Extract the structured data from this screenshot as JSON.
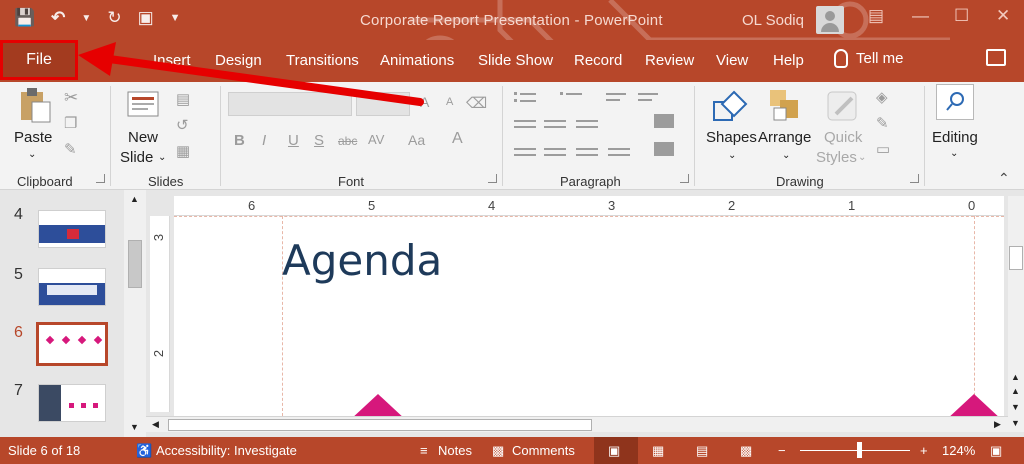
{
  "window": {
    "doc_title": "Corporate Report Presentation  -  PowerPoint",
    "user_name": "OL Sodiq"
  },
  "tabs": {
    "file": "File",
    "items": [
      "Insert",
      "Design",
      "Transitions",
      "Animations",
      "Slide Show",
      "Record",
      "Review",
      "View",
      "Help"
    ],
    "tell_me": "Tell me"
  },
  "ribbon": {
    "clipboard": {
      "paste": "Paste",
      "label": "Clipboard"
    },
    "slides": {
      "new_slide_1": "New",
      "new_slide_2": "Slide",
      "label": "Slides"
    },
    "font": {
      "label": "Font",
      "bold": "B",
      "italic": "I",
      "underline": "U",
      "strike": "S",
      "abc": "abc",
      "spacing": "AV",
      "case": "Aa",
      "grow": "A",
      "shrink": "A"
    },
    "paragraph": {
      "label": "Paragraph"
    },
    "drawing": {
      "shapes": "Shapes",
      "arrange": "Arrange",
      "quick_styles_1": "Quick",
      "quick_styles_2": "Styles",
      "label": "Drawing"
    },
    "editing": {
      "label": "Editing"
    }
  },
  "thumbnails": [
    {
      "number": "4",
      "active": false
    },
    {
      "number": "5",
      "active": false
    },
    {
      "number": "6",
      "active": true
    },
    {
      "number": "7",
      "active": false
    }
  ],
  "ruler": {
    "horizontal": [
      "6",
      "5",
      "4",
      "3",
      "2",
      "1",
      "0"
    ],
    "vertical": [
      "3",
      "2"
    ]
  },
  "slide": {
    "title": "Agenda"
  },
  "status": {
    "slide_count": "Slide 6 of 18",
    "accessibility": "Accessibility: Investigate",
    "notes": "Notes",
    "comments": "Comments",
    "zoom": "124%",
    "zoom_minus": "−",
    "zoom_plus": "+"
  },
  "colors": {
    "accent": "#b7472a",
    "annotation": "#e60000",
    "slide_title": "#1e3a5a",
    "shape_pink": "#d6187c"
  }
}
